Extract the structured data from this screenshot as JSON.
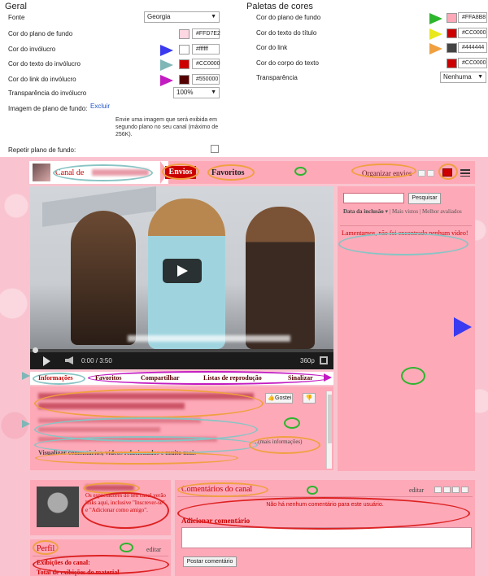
{
  "geral": {
    "title": "Geral",
    "fonte_label": "Fonte",
    "fonte_value": "Georgia",
    "rows": [
      {
        "label": "Cor do plano de fundo",
        "color": "#FFD7E2",
        "hex": "#FFD7E2"
      },
      {
        "label": "Cor do invólucro",
        "color": "#FFFFFF",
        "hex": "#ffffff"
      },
      {
        "label": "Cor do texto do invólucro",
        "color": "#CC0000",
        "hex": "#CC0000"
      },
      {
        "label": "Cor do link do invólucro",
        "color": "#550000",
        "hex": "#550000"
      }
    ],
    "transparencia_label": "Transparência do invólucro",
    "transparencia_value": "100%",
    "imagem_label": "Imagem de plano de fundo:",
    "excluir_label": "Excluir",
    "imagem_help": "Envie uma imagem que será exibida em segundo plano no seu canal (máximo de 256K).",
    "repetir_label": "Repetir plano de fundo:"
  },
  "paletas": {
    "title": "Paletas de cores",
    "rows": [
      {
        "label": "Cor do plano de fundo",
        "color": "#FFA8B8",
        "hex": "#FFA8B8"
      },
      {
        "label": "Cor do texto do título",
        "color": "#CC0000",
        "hex": "#CC0000"
      },
      {
        "label": "Cor do link",
        "color": "#444444",
        "hex": "#444444"
      },
      {
        "label": "Cor do corpo do texto",
        "color": "#CC0000",
        "hex": "#CC0000"
      }
    ],
    "transparencia_label": "Transparência",
    "transparencia_value": "Nenhuma"
  },
  "colors": {
    "arrow_blue": "#3a3af0",
    "arrow_teal": "#7fb6b6",
    "arrow_magenta": "#c21bc2",
    "arrow_green": "#2db52d",
    "arrow_yellow": "#e8e81c",
    "arrow_orange": "#f0a040",
    "oval_teal": "#88c4c4",
    "oval_orange": "#f0a040",
    "oval_magenta": "#c21bc2",
    "oval_red": "#dd2222",
    "accent": "#cc0000"
  },
  "channel": {
    "title": "Canal de",
    "tabs": {
      "envios": "Envios",
      "favoritos": "Favoritos"
    },
    "organizar": "Organizar envios",
    "search_button": "Pesquisar",
    "sort_active": "Data da inclusão",
    "sort_mais_vistos": "Mais vistos",
    "sort_mais_avaliados": "Melhor avaliados",
    "no_video": "Lamentamos, não foi encontrado nenhum vídeo!",
    "player": {
      "time": "0:00 / 3:50",
      "quality": "360p"
    },
    "video_tabs": [
      "Informações",
      "Favoritos",
      "Compartilhar",
      "Listas de reprodução",
      "Sinalizar"
    ],
    "gostei": "Gostei",
    "mais_info": "...(mais informações)",
    "visualizar": "Visualizar comentários, vídeos relacionados e muito mais",
    "links_text": "Os espectadores do seu canal verão links aqui, inclusive \"Inscrever-se\" e \"Adicionar como amigo\".",
    "comments_title": "Comentários do canal",
    "editar": "editar",
    "no_comments": "Não há nenhum comentário para este usuário.",
    "add_comment": "Adicionar comentário",
    "post_comment": "Postar comentário",
    "perfil_title": "Perfil",
    "perfil_editar": "editar",
    "exibicoes_canal": "Exibições do canal:",
    "total_exibicoes": "Total de exibições do material"
  }
}
